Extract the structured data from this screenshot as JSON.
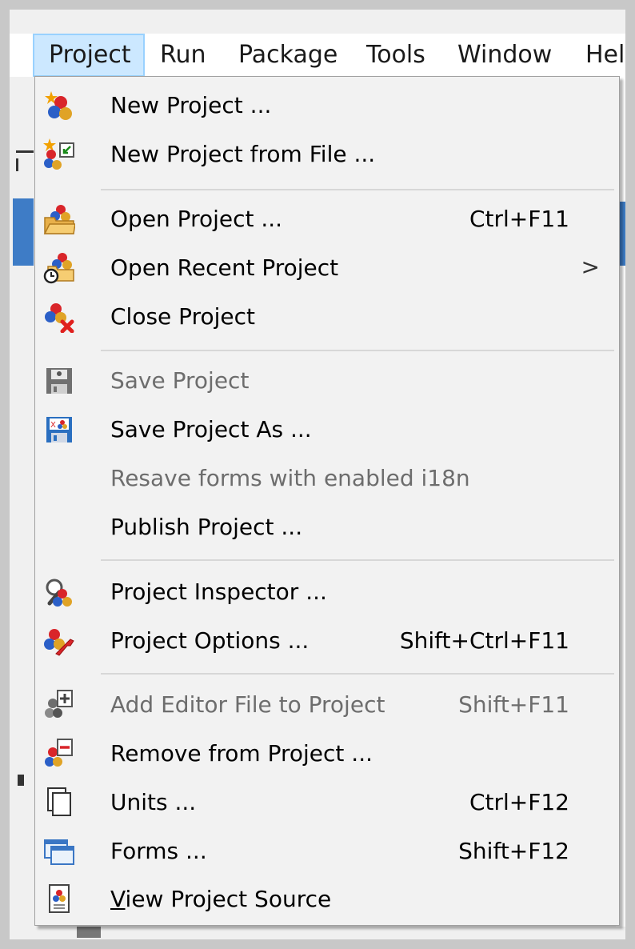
{
  "menubar": {
    "items": [
      {
        "label": "Project"
      },
      {
        "label": "Run"
      },
      {
        "label": "Package"
      },
      {
        "label": "Tools"
      },
      {
        "label": "Window"
      },
      {
        "label": "Help"
      }
    ]
  },
  "menu": {
    "items": [
      {
        "label": "New Project ...",
        "shortcut": "",
        "icon": "new-project-icon",
        "enabled": true
      },
      {
        "label": "New Project from File ...",
        "shortcut": "",
        "icon": "new-project-from-file-icon",
        "enabled": true
      },
      {
        "label": "Open Project ...",
        "shortcut": "Ctrl+F11",
        "icon": "open-project-icon",
        "enabled": true
      },
      {
        "label": "Open Recent Project",
        "shortcut": "",
        "icon": "open-recent-project-icon",
        "enabled": true,
        "submenu": ">"
      },
      {
        "label": "Close Project",
        "shortcut": "",
        "icon": "close-project-icon",
        "enabled": true
      },
      {
        "label": "Save Project",
        "shortcut": "",
        "icon": "save-project-icon",
        "enabled": false
      },
      {
        "label": "Save Project As ...",
        "shortcut": "",
        "icon": "save-project-as-icon",
        "enabled": true
      },
      {
        "label": "Resave forms with enabled i18n",
        "shortcut": "",
        "icon": "",
        "enabled": false
      },
      {
        "label": "Publish Project ...",
        "shortcut": "",
        "icon": "",
        "enabled": true
      },
      {
        "label": "Project Inspector ...",
        "shortcut": "",
        "icon": "project-inspector-icon",
        "enabled": true
      },
      {
        "label": "Project Options ...",
        "shortcut": "Shift+Ctrl+F11",
        "icon": "project-options-icon",
        "enabled": true
      },
      {
        "label": "Add Editor File to Project",
        "shortcut": "Shift+F11",
        "icon": "add-file-icon",
        "enabled": false
      },
      {
        "label": "Remove from Project ...",
        "shortcut": "",
        "icon": "remove-file-icon",
        "enabled": true
      },
      {
        "label": "Units ...",
        "shortcut": "Ctrl+F12",
        "icon": "units-icon",
        "enabled": true
      },
      {
        "label": "Forms ...",
        "shortcut": "Shift+F12",
        "icon": "forms-icon",
        "enabled": true
      },
      {
        "label": "View Project Source",
        "shortcut": "",
        "icon": "view-source-icon",
        "enabled": true,
        "accelerator": "V"
      }
    ]
  }
}
